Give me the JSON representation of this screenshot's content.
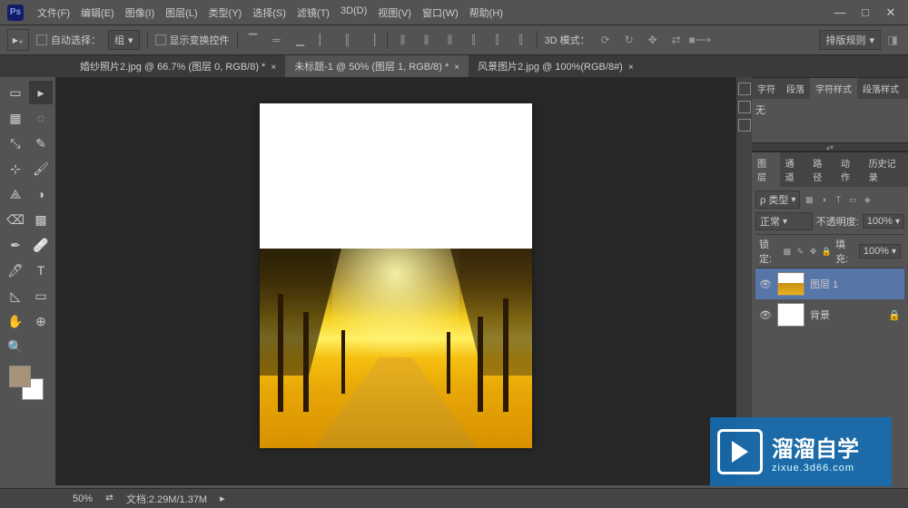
{
  "app": {
    "logo": "Ps"
  },
  "menus": [
    "文件(F)",
    "编辑(E)",
    "图像(I)",
    "图层(L)",
    "类型(Y)",
    "选择(S)",
    "滤镜(T)",
    "3D(D)",
    "视图(V)",
    "窗口(W)",
    "帮助(H)"
  ],
  "optbar": {
    "tool_glyph": "▸₊",
    "auto_select_label": "自动选择：",
    "dd1": "组",
    "transform_label": "显示变换控件",
    "mode3d_label": "3D 模式：",
    "right_btn": "排版规则"
  },
  "tabs": [
    {
      "label": "婚纱照片2.jpg @ 66.7% (图层 0, RGB/8) *",
      "active": false
    },
    {
      "label": "未标题-1 @ 50% (图层 1, RGB/8) *",
      "active": true
    },
    {
      "label": "风景图片2.jpg @ 100%(RGB/8#)",
      "active": false
    }
  ],
  "tools": [
    "▭",
    "▸",
    "▦",
    "◌",
    "⤡",
    "✎",
    "⊹",
    "🖌",
    "⟁",
    "◑",
    "⌫",
    "▩",
    "✒",
    "🩹",
    "🖊",
    "T",
    "◺",
    "▭",
    "✋",
    "⊕",
    "🔍"
  ],
  "char_panel": {
    "tabs": [
      "字符",
      "段落",
      "字符样式",
      "段落样式"
    ],
    "active_tab": 2,
    "placeholder": "无"
  },
  "layers_panel": {
    "tabs": [
      "图层",
      "通道",
      "路径",
      "动作",
      "历史记录"
    ],
    "kind_label": "ρ 类型",
    "blend": "正常",
    "opacity_label": "不透明度:",
    "opacity": "100%",
    "lock_label": "锁定:",
    "fill_label": "填充:",
    "fill": "100%",
    "layers": [
      {
        "name": "图层 1",
        "selected": true,
        "bg": false
      },
      {
        "name": "背景",
        "selected": false,
        "bg": true
      }
    ]
  },
  "statusbar": {
    "zoom": "50%",
    "info": "文档:2.29M/1.37M"
  },
  "watermark": {
    "title": "溜溜自学",
    "url": "zixue.3d66.com"
  }
}
